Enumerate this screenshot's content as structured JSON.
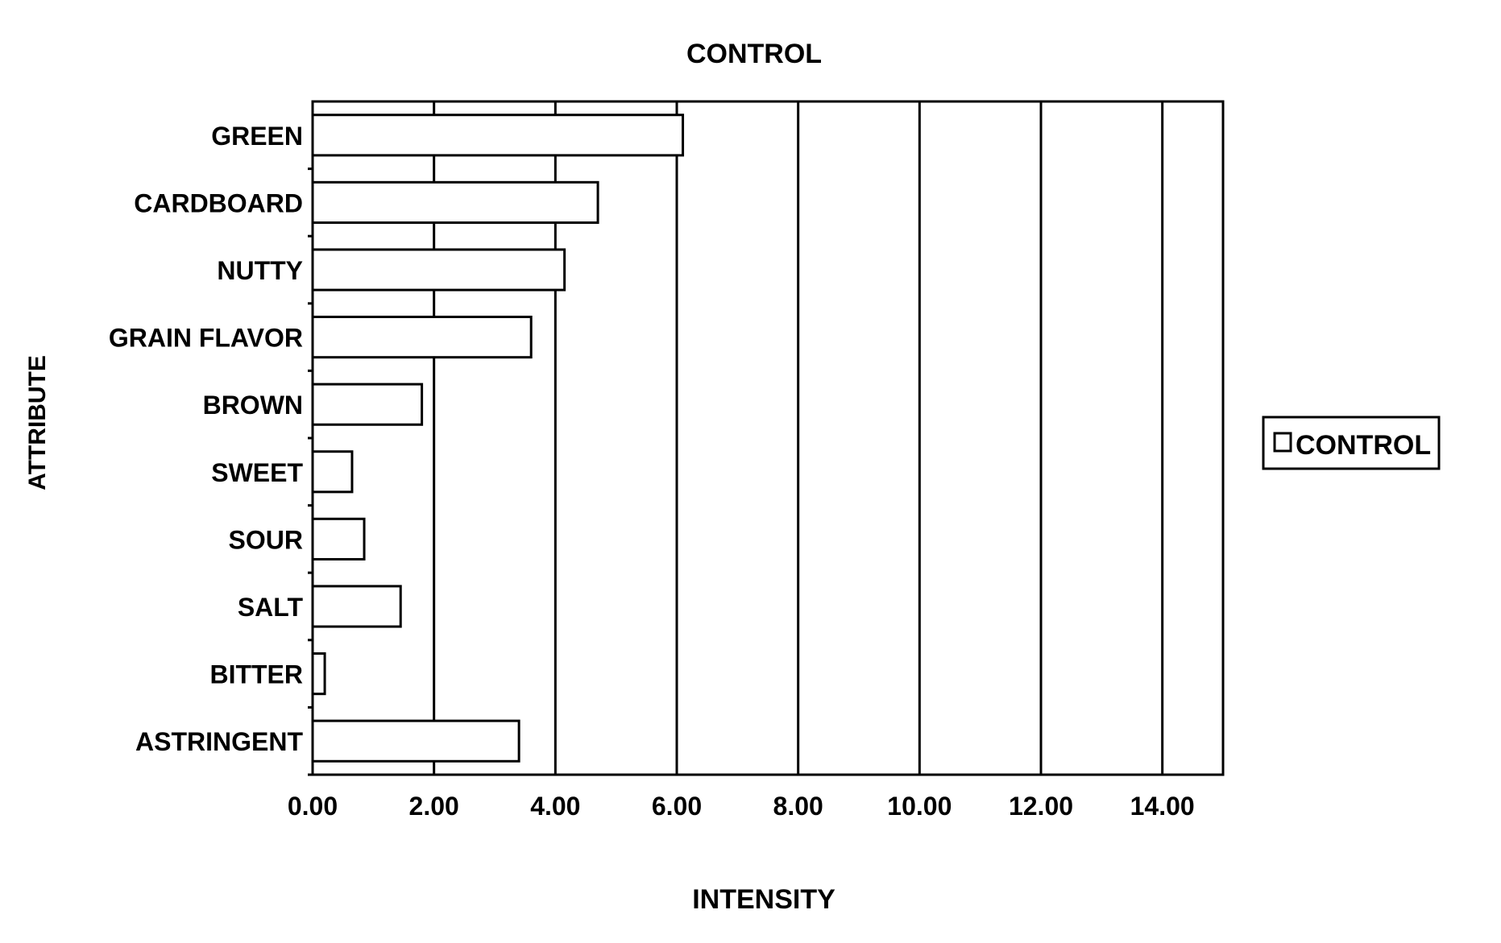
{
  "chart_data": {
    "type": "bar",
    "orientation": "horizontal",
    "title": "CONTROL",
    "xlabel": "INTENSITY",
    "ylabel": "ATTRIBUTE",
    "categories": [
      "GREEN",
      "CARDBOARD",
      "NUTTY",
      "GRAIN FLAVOR",
      "BROWN",
      "SWEET",
      "SOUR",
      "SALT",
      "BITTER",
      "ASTRINGENT"
    ],
    "series": [
      {
        "name": "CONTROL",
        "values": [
          6.1,
          4.7,
          4.15,
          3.6,
          1.8,
          0.65,
          0.85,
          1.45,
          0.2,
          3.4
        ]
      }
    ],
    "xlim": [
      0,
      15
    ],
    "xticks": [
      0,
      2,
      4,
      6,
      8,
      10,
      12,
      14
    ],
    "xtick_labels": [
      "0.00",
      "2.00",
      "4.00",
      "6.00",
      "8.00",
      "10.00",
      "12.00",
      "14.00"
    ],
    "grid": "vertical",
    "legend": {
      "entries": [
        "CONTROL"
      ],
      "placement": "right"
    },
    "bar_fill": "#ffffff",
    "bar_stroke": "#000000"
  }
}
